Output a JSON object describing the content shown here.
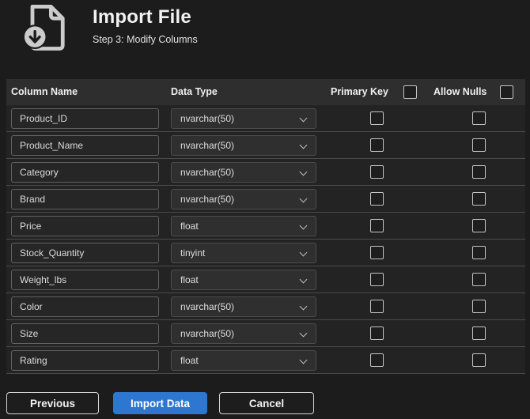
{
  "header": {
    "title": "Import File",
    "subtitle": "Step 3: Modify Columns",
    "icon": "file-download-icon"
  },
  "table": {
    "columns": {
      "name": "Column Name",
      "type": "Data Type",
      "primary_key": "Primary Key",
      "allow_nulls": "Allow Nulls"
    },
    "select_all": {
      "primary_key_checked": false,
      "allow_nulls_checked": false
    },
    "rows": [
      {
        "name": "Product_ID",
        "type": "nvarchar(50)",
        "primary_key": false,
        "allow_nulls": false
      },
      {
        "name": "Product_Name",
        "type": "nvarchar(50)",
        "primary_key": false,
        "allow_nulls": false
      },
      {
        "name": "Category",
        "type": "nvarchar(50)",
        "primary_key": false,
        "allow_nulls": false
      },
      {
        "name": "Brand",
        "type": "nvarchar(50)",
        "primary_key": false,
        "allow_nulls": false
      },
      {
        "name": "Price",
        "type": "float",
        "primary_key": false,
        "allow_nulls": false
      },
      {
        "name": "Stock_Quantity",
        "type": "tinyint",
        "primary_key": false,
        "allow_nulls": false
      },
      {
        "name": "Weight_lbs",
        "type": "float",
        "primary_key": false,
        "allow_nulls": false
      },
      {
        "name": "Color",
        "type": "nvarchar(50)",
        "primary_key": false,
        "allow_nulls": false
      },
      {
        "name": "Size",
        "type": "nvarchar(50)",
        "primary_key": false,
        "allow_nulls": false
      },
      {
        "name": "Rating",
        "type": "float",
        "primary_key": false,
        "allow_nulls": false
      }
    ]
  },
  "footer": {
    "previous_label": "Previous",
    "import_label": "Import Data",
    "cancel_label": "Cancel"
  },
  "colors": {
    "accent_blue": "#2e77d0",
    "page_bg": "#1c1c1c",
    "table_header_bg": "#2e2e2e",
    "table_body_bg": "#232323",
    "icon_gray": "#cccccc"
  }
}
